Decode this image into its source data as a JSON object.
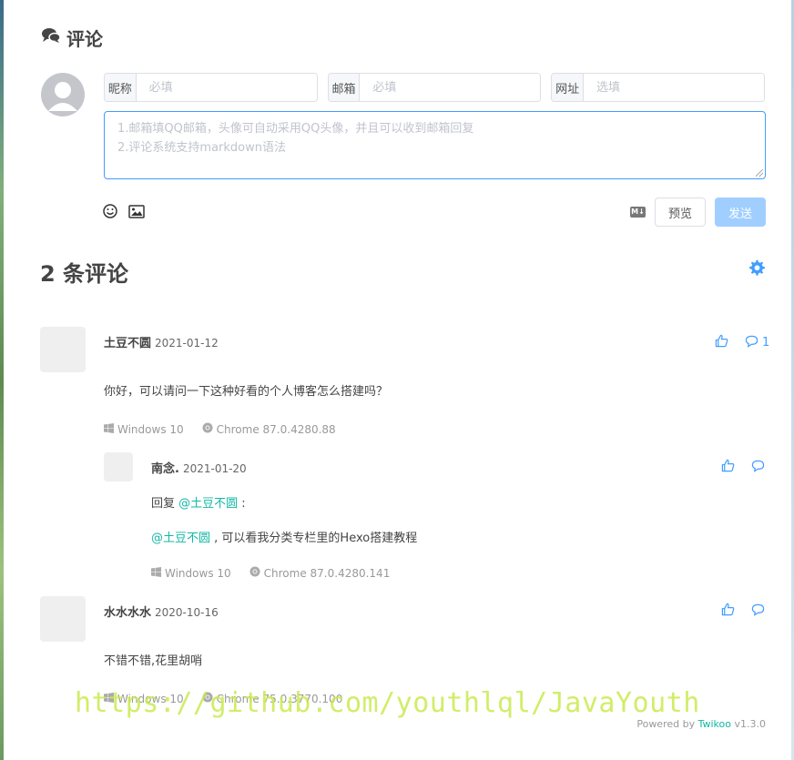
{
  "header": {
    "title": "评论"
  },
  "form": {
    "nick": {
      "label": "昵称",
      "placeholder": "必填"
    },
    "mail": {
      "label": "邮箱",
      "placeholder": "必填"
    },
    "link": {
      "label": "网址",
      "placeholder": "选填"
    },
    "textarea_placeholder_line1": "1.邮箱填QQ邮箱，头像可自动采用QQ头像，并且可以收到邮箱回复",
    "textarea_placeholder_line2": "2.评论系统支持markdown语法",
    "md_label": "M↓",
    "preview_label": "预览",
    "send_label": "发送"
  },
  "comments_count_label": "2 条评论",
  "comments": [
    {
      "author": "土豆不圆",
      "date": "2021-01-12",
      "text": "你好，可以请问一下这种好看的个人博客怎么搭建吗？",
      "os": "Windows 10",
      "browser": "Chrome 87.0.4280.88",
      "reply_count": "1",
      "replies": [
        {
          "author": "南念.",
          "date": "2021-01-20",
          "line1_prefix": "回复 ",
          "line1_mention": "@土豆不圆",
          "line1_suffix": " :",
          "line2_mention": "@土豆不圆",
          "line2_text": " , 可以看我分类专栏里的Hexo搭建教程",
          "os": "Windows 10",
          "browser": "Chrome 87.0.4280.141"
        }
      ]
    },
    {
      "author": "水水水水",
      "date": "2020-10-16",
      "text": "不错不错,花里胡哨",
      "os": "Windows 10",
      "browser": "Chrome 75.0.3770.100"
    }
  ],
  "watermark": "https://github.com/youthlql/JavaYouth",
  "footer": {
    "prefix": "Powered by ",
    "brand": "Twikoo",
    "version": " v1.3.0"
  },
  "colors": {
    "accent": "#409eff",
    "mention": "#10b8a3",
    "send_disabled": "#a0cfff"
  },
  "icons": [
    "comments-icon",
    "default-avatar-icon",
    "emoji-icon",
    "image-icon",
    "markdown-icon",
    "gear-icon",
    "thumb-up-icon",
    "reply-icon",
    "windows-icon",
    "chrome-icon"
  ]
}
